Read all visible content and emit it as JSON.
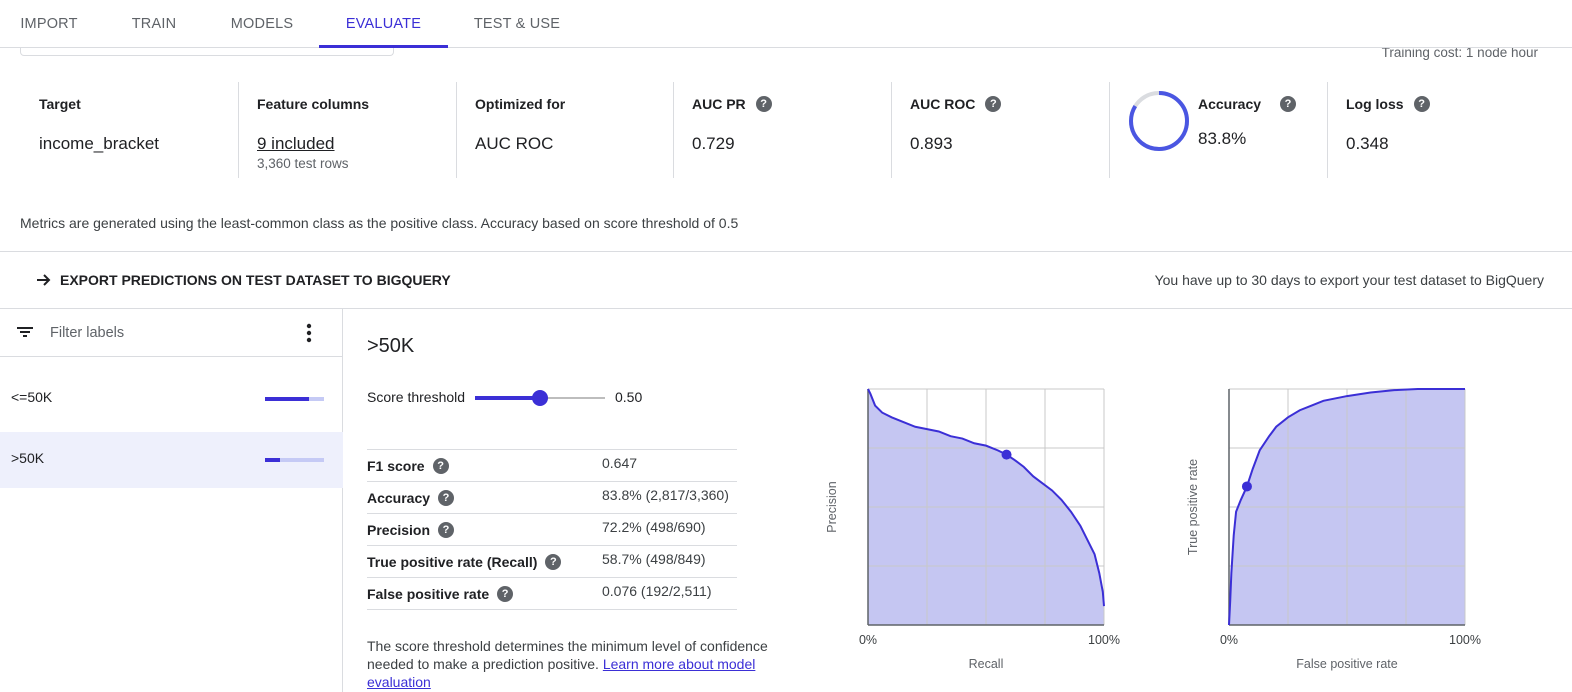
{
  "tabs": [
    {
      "label": "IMPORT",
      "active": false
    },
    {
      "label": "TRAIN",
      "active": false
    },
    {
      "label": "MODELS",
      "active": false
    },
    {
      "label": "EVALUATE",
      "active": true
    },
    {
      "label": "TEST & USE",
      "active": false
    }
  ],
  "training_cost": "Training cost: 1 node hour",
  "metrics": {
    "target": {
      "label": "Target",
      "value": "income_bracket"
    },
    "feature_columns": {
      "label": "Feature columns",
      "value": "9 included",
      "sub": "3,360 test rows"
    },
    "optimized_for": {
      "label": "Optimized for",
      "value": "AUC ROC"
    },
    "auc_pr": {
      "label": "AUC PR",
      "value": "0.729"
    },
    "auc_roc": {
      "label": "AUC ROC",
      "value": "0.893"
    },
    "accuracy": {
      "label": "Accuracy",
      "value": "83.8%",
      "fraction": 0.838
    },
    "log_loss": {
      "label": "Log loss",
      "value": "0.348"
    }
  },
  "metrics_note": "Metrics are generated using the least-common class as the positive class. Accuracy based on score threshold of 0.5",
  "export": {
    "label": "EXPORT PREDICTIONS ON TEST DATASET TO BIGQUERY",
    "note": "You have up to 30 days to export your test dataset to BigQuery"
  },
  "filter": {
    "placeholder": "Filter labels"
  },
  "labels": [
    {
      "name": "<=50K",
      "bar_fraction": 0.74,
      "selected": false
    },
    {
      "name": ">50K",
      "bar_fraction": 0.26,
      "selected": true
    }
  ],
  "detail": {
    "title": ">50K",
    "threshold_label": "Score threshold",
    "threshold_value": "0.50",
    "threshold": 0.5,
    "stats": [
      {
        "name": "F1 score",
        "value": "0.647"
      },
      {
        "name": "Accuracy",
        "value": "83.8% (2,817/3,360)"
      },
      {
        "name": "Precision",
        "value": "72.2% (498/690)"
      },
      {
        "name": "True positive rate (Recall)",
        "value": "58.7% (498/849)"
      },
      {
        "name": "False positive rate",
        "value": "0.076 (192/2,511)"
      }
    ],
    "explanation": "The score threshold determines the minimum level of confidence needed to make a prediction positive.",
    "learn_more": "Learn more about model evaluation"
  },
  "colors": {
    "accent": "#3b2fd6",
    "fill": "#c5c6f2",
    "grid": "#c8c8c8"
  },
  "chart_data": [
    {
      "type": "area",
      "xlabel": "Recall",
      "ylabel": "Precision",
      "xtick_labels": [
        "0%",
        "100%"
      ],
      "xlim": [
        0,
        1
      ],
      "ylim": [
        0,
        1
      ],
      "grid": true,
      "x": [
        0.0,
        0.01,
        0.03,
        0.06,
        0.1,
        0.15,
        0.2,
        0.25,
        0.3,
        0.35,
        0.4,
        0.45,
        0.5,
        0.55,
        0.587,
        0.62,
        0.66,
        0.7,
        0.74,
        0.78,
        0.82,
        0.86,
        0.9,
        0.93,
        0.96,
        0.98,
        0.995,
        1.0
      ],
      "y": [
        1.0,
        0.98,
        0.93,
        0.9,
        0.88,
        0.86,
        0.84,
        0.83,
        0.82,
        0.8,
        0.79,
        0.77,
        0.76,
        0.74,
        0.722,
        0.7,
        0.67,
        0.63,
        0.6,
        0.57,
        0.53,
        0.48,
        0.42,
        0.36,
        0.3,
        0.22,
        0.14,
        0.08
      ],
      "marker": {
        "x": 0.587,
        "y": 0.722
      }
    },
    {
      "type": "area",
      "xlabel": "False positive rate",
      "ylabel": "True positive rate",
      "xtick_labels": [
        "0%",
        "100%"
      ],
      "xlim": [
        0,
        1
      ],
      "ylim": [
        0,
        1
      ],
      "grid": true,
      "x": [
        0.0,
        0.005,
        0.01,
        0.02,
        0.03,
        0.05,
        0.076,
        0.1,
        0.13,
        0.17,
        0.2,
        0.25,
        0.3,
        0.35,
        0.4,
        0.5,
        0.6,
        0.7,
        0.8,
        0.9,
        1.0
      ],
      "y": [
        0.0,
        0.1,
        0.22,
        0.38,
        0.48,
        0.53,
        0.587,
        0.66,
        0.74,
        0.8,
        0.84,
        0.88,
        0.91,
        0.93,
        0.95,
        0.97,
        0.985,
        0.995,
        1.0,
        1.0,
        1.0
      ],
      "marker": {
        "x": 0.076,
        "y": 0.587
      }
    }
  ]
}
